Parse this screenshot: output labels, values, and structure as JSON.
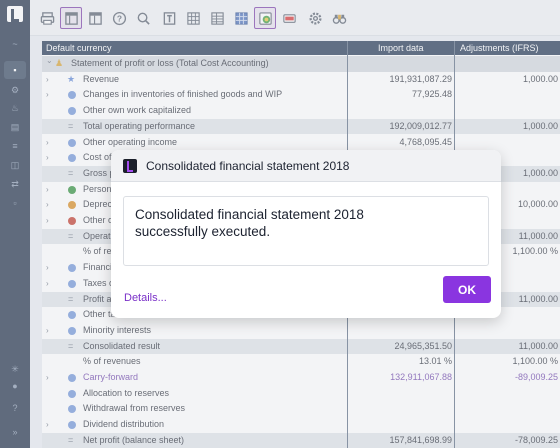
{
  "toolbar": {
    "icons": [
      "print-icon",
      "layout-icon",
      "panel-icon",
      "help-icon",
      "search-icon",
      "text-icon",
      "grid-icon",
      "table-icon",
      "blue-grid-icon",
      "export-icon",
      "stop-icon",
      "settings-icon",
      "binoculars-icon"
    ]
  },
  "rail": {
    "icons": [
      "dash-icon",
      "chart-icon",
      "gear-icon",
      "flame-icon",
      "doc-icon",
      "list-icon",
      "layers-icon",
      "share-icon",
      "file-icon",
      "star-icon",
      "user-icon",
      "help-icon",
      "expand-icon"
    ]
  },
  "grid": {
    "headers": {
      "name": "Default currency",
      "import": "Import data",
      "adjust": "Adjustments (IFRS)"
    },
    "rows": [
      {
        "label": "Statement of profit or loss (Total Cost Accounting)",
        "v1": "",
        "v2": "",
        "marker": "person",
        "chev": "down"
      },
      {
        "label": "Revenue",
        "v1": "191,931,087.29",
        "v2": "1,000.00",
        "marker": "star",
        "chev": "right"
      },
      {
        "label": "Changes in inventories of finished goods and WIP",
        "v1": "77,925.48",
        "v2": "",
        "marker": "dot",
        "chev": "right"
      },
      {
        "label": "Other own work capitalized",
        "v1": "",
        "v2": "",
        "marker": "dot",
        "chev": ""
      },
      {
        "label": "Total operating performance",
        "v1": "192,009,012.77",
        "v2": "1,000.00",
        "marker": "eq",
        "chev": ""
      },
      {
        "label": "Other operating income",
        "v1": "4,768,095.45",
        "v2": "",
        "marker": "dot",
        "chev": "right"
      },
      {
        "label": "Cost of",
        "v1": "",
        "v2": "",
        "marker": "dot",
        "chev": "right"
      },
      {
        "label": "Gross p",
        "v1": "",
        "v2": "1,000.00",
        "marker": "eq",
        "chev": ""
      },
      {
        "label": "Person",
        "v1": "",
        "v2": "",
        "marker": "green",
        "chev": "right"
      },
      {
        "label": "Deprec",
        "v1": "",
        "v2": "10,000.00",
        "marker": "orange",
        "chev": "right"
      },
      {
        "label": "Other o",
        "v1": "",
        "v2": "",
        "marker": "red",
        "chev": "right"
      },
      {
        "label": "Operati",
        "v1": "",
        "v2": "11,000.00",
        "marker": "eq",
        "chev": ""
      },
      {
        "label": "% of re",
        "v1": "",
        "v2": "1,100.00 %",
        "marker": "",
        "chev": ""
      },
      {
        "label": "Financi",
        "v1": "",
        "v2": "",
        "marker": "dot",
        "chev": "right"
      },
      {
        "label": "Taxes o",
        "v1": "",
        "v2": "",
        "marker": "dot",
        "chev": "right"
      },
      {
        "label": "Profit a",
        "v1": "",
        "v2": "11,000.00",
        "marker": "eq",
        "chev": ""
      },
      {
        "label": "Other ta",
        "v1": "",
        "v2": "",
        "marker": "dot",
        "chev": ""
      },
      {
        "label": "Minority interests",
        "v1": "",
        "v2": "",
        "marker": "dot",
        "chev": "right"
      },
      {
        "label": "Consolidated result",
        "v1": "24,965,351.50",
        "v2": "11,000.00",
        "marker": "eq",
        "chev": ""
      },
      {
        "label": "% of revenues",
        "v1": "13.01 %",
        "v2": "1,100.00 %",
        "marker": "",
        "chev": ""
      },
      {
        "label": "Carry-forward",
        "v1": "132,911,067.88",
        "v2": "-89,009.25",
        "marker": "dot",
        "chev": "right",
        "link": true
      },
      {
        "label": "Allocation to reserves",
        "v1": "",
        "v2": "",
        "marker": "dot",
        "chev": ""
      },
      {
        "label": "Withdrawal from reserves",
        "v1": "",
        "v2": "",
        "marker": "dot",
        "chev": ""
      },
      {
        "label": "Dividend distribution",
        "v1": "",
        "v2": "",
        "marker": "dot",
        "chev": "right"
      },
      {
        "label": "Net profit (balance sheet)",
        "v1": "157,841,698.99",
        "v2": "-78,009.25",
        "marker": "eq",
        "chev": ""
      }
    ]
  },
  "dialog": {
    "title": "Consolidated financial statement 2018",
    "message": "Consolidated financial statement 2018 successfully executed.",
    "details_label": "Details...",
    "ok_label": "OK"
  },
  "colors": {
    "accent": "#8a35e0",
    "header": "#1f3350",
    "rail": "#1e2d45"
  }
}
